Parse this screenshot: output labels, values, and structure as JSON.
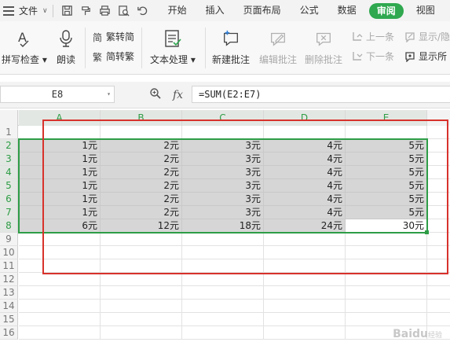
{
  "menubar": {
    "file_label": "文件",
    "tabs": [
      {
        "label": "开始",
        "active": false
      },
      {
        "label": "插入",
        "active": false
      },
      {
        "label": "页面布局",
        "active": false
      },
      {
        "label": "公式",
        "active": false
      },
      {
        "label": "数据",
        "active": false
      },
      {
        "label": "审阅",
        "active": true
      },
      {
        "label": "视图",
        "active": false
      }
    ]
  },
  "ribbon": {
    "spellcheck": "拼写检查",
    "read_aloud": "朗读",
    "trad_to_simp": "繁转简",
    "simp_to_trad": "简转繁",
    "text_processing": "文本处理",
    "new_comment": "新建批注",
    "edit_comment": "编辑批注",
    "delete_comment": "删除批注",
    "prev_comment": "上一条",
    "next_comment": "下一条",
    "show_hide_comment": "显示/隐",
    "show_all_comments": "显示所"
  },
  "formula_bar": {
    "name_box": "E8",
    "fx_label": "fx",
    "formula": "=SUM(E2:E7)"
  },
  "grid": {
    "columns": [
      "A",
      "B",
      "C",
      "D",
      "E"
    ],
    "rows": [
      "1",
      "2",
      "3",
      "4",
      "5",
      "6",
      "7",
      "8",
      "9",
      "10",
      "11",
      "12",
      "13",
      "14",
      "15",
      "16"
    ],
    "data": [
      [
        "1元",
        "2元",
        "3元",
        "4元",
        "5元"
      ],
      [
        "1元",
        "2元",
        "3元",
        "4元",
        "5元"
      ],
      [
        "1元",
        "2元",
        "3元",
        "4元",
        "5元"
      ],
      [
        "1元",
        "2元",
        "3元",
        "4元",
        "5元"
      ],
      [
        "1元",
        "2元",
        "3元",
        "4元",
        "5元"
      ],
      [
        "1元",
        "2元",
        "3元",
        "4元",
        "5元"
      ],
      [
        "6元",
        "12元",
        "18元",
        "24元",
        "30元"
      ]
    ],
    "active_cell": "E8"
  },
  "colors": {
    "accent": "#2fa84f",
    "selection": "#2e9d46",
    "annotation_box": "#d8322c"
  },
  "watermark": {
    "text": "Baidu",
    "sub": "经验"
  }
}
